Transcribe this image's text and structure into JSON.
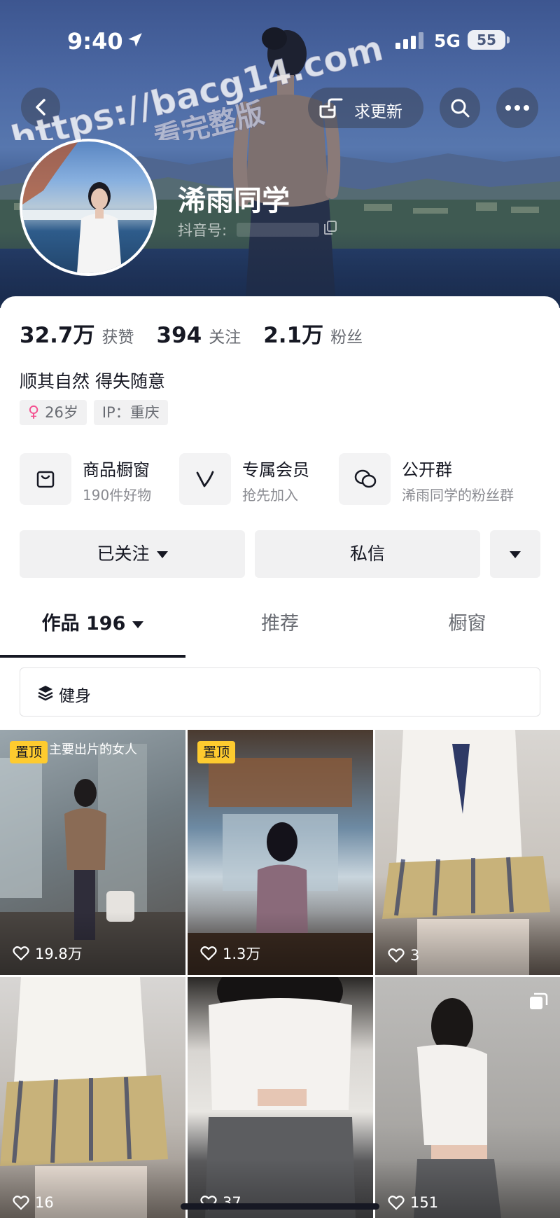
{
  "status_bar": {
    "time": "9:40",
    "network": "5G",
    "battery": "55"
  },
  "header": {
    "request_update_label": "求更新"
  },
  "profile": {
    "name": "浠雨同学",
    "douyin_id_label": "抖音号:",
    "stats": [
      {
        "value": "32.7万",
        "label": "获赞"
      },
      {
        "value": "394",
        "label": "关注"
      },
      {
        "value": "2.1万",
        "label": "粉丝"
      }
    ],
    "bio": "顺其自然 得失随意",
    "tags": {
      "age": "26岁",
      "ip": "IP：重庆"
    }
  },
  "services": [
    {
      "title": "商品橱窗",
      "subtitle": "190件好物",
      "icon": "shopping-bag-icon"
    },
    {
      "title": "专属会员",
      "subtitle": "抢先加入",
      "icon": "member-v-icon"
    },
    {
      "title": "公开群",
      "subtitle": "浠雨同学的粉丝群",
      "icon": "chat-bubbles-icon"
    }
  ],
  "actions": {
    "follow_label": "已关注",
    "message_label": "私信"
  },
  "tabs": [
    {
      "label": "作品 196",
      "active": true
    },
    {
      "label": "推荐",
      "active": false
    },
    {
      "label": "橱窗",
      "active": false
    }
  ],
  "filter": {
    "label": "健身"
  },
  "videos": [
    {
      "pinned": true,
      "pin_label": "置顶",
      "likes": "19.8万",
      "caption": "主要出片的女人"
    },
    {
      "pinned": true,
      "pin_label": "置顶",
      "likes": "1.3万"
    },
    {
      "pinned": false,
      "likes": "3"
    },
    {
      "pinned": false,
      "likes": "16"
    },
    {
      "pinned": false,
      "likes": "37"
    },
    {
      "pinned": false,
      "likes": "151",
      "multi_image": true
    }
  ],
  "watermark": {
    "line1": "https://bacg14.com",
    "line2": "看完整版"
  },
  "colors": {
    "accent_pin": "#fecb2f",
    "text_primary": "#161823",
    "text_secondary": "#686b72",
    "gender_female": "#f44f8f"
  }
}
